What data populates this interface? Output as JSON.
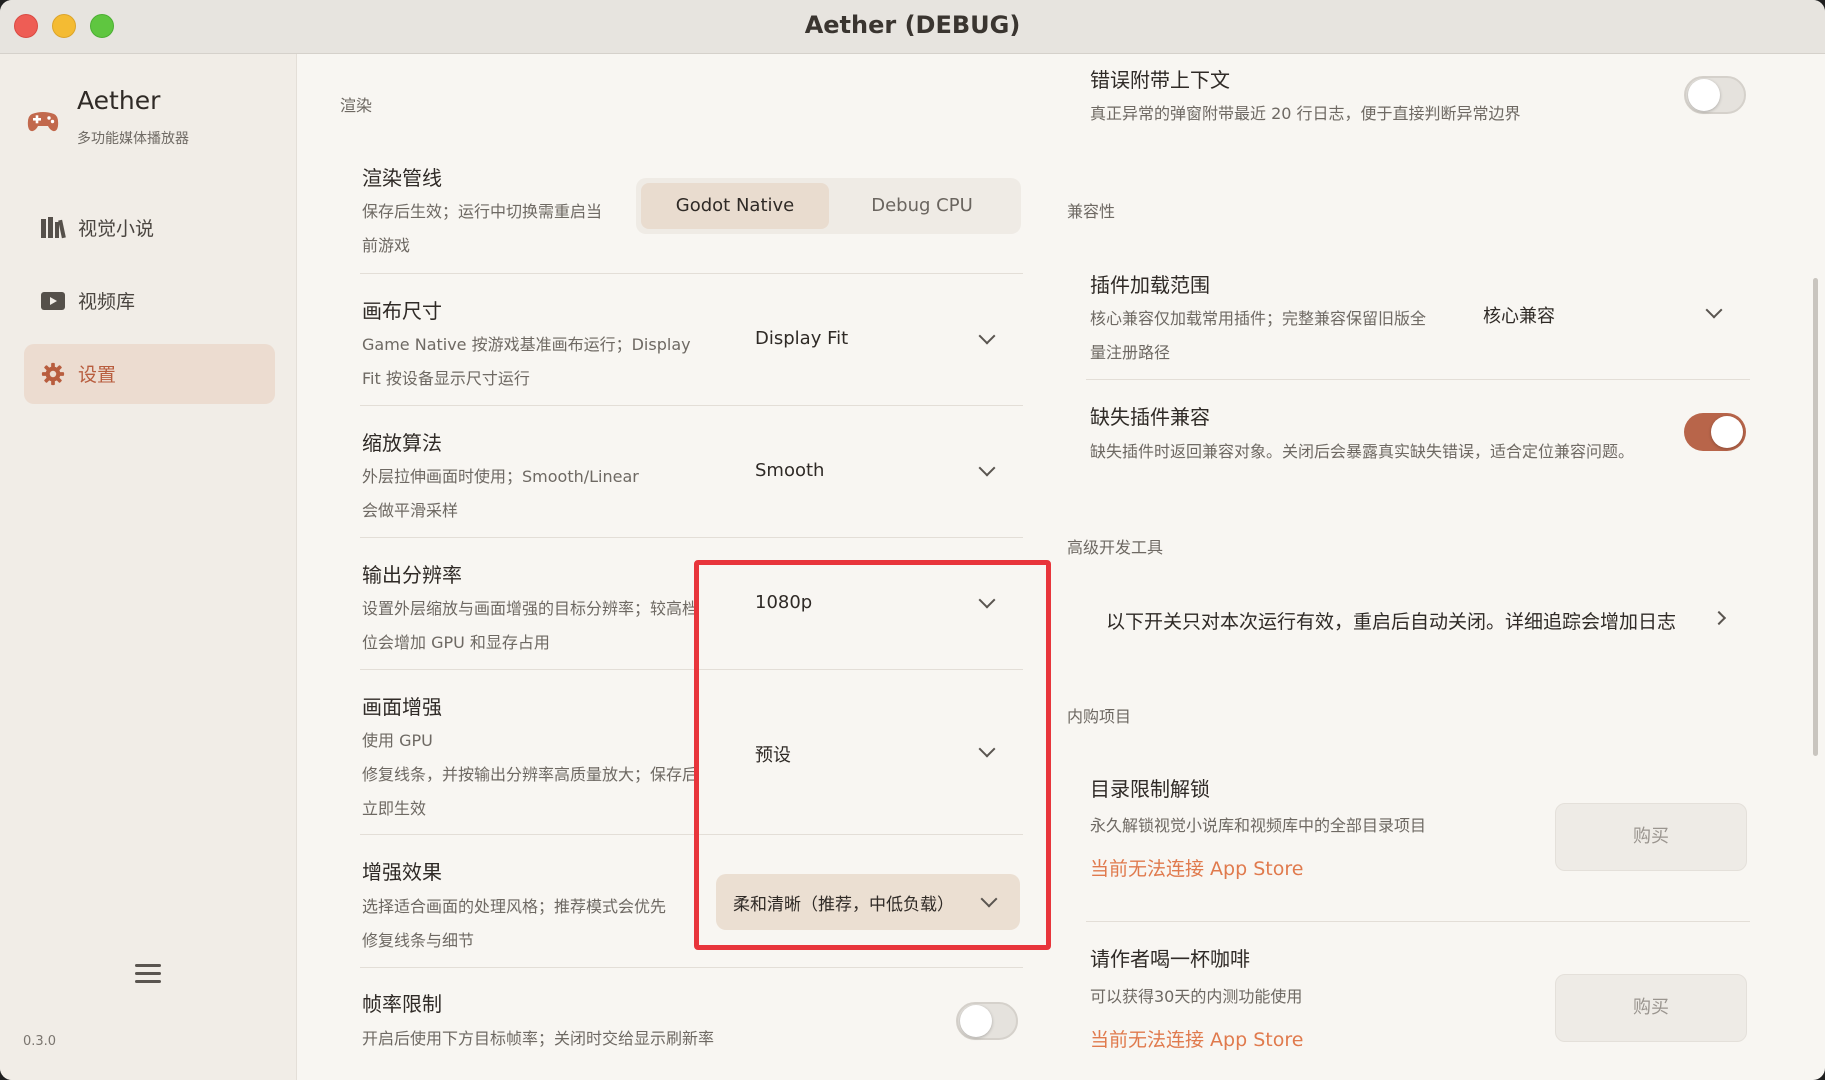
{
  "window": {
    "title": "Aether (DEBUG)"
  },
  "sidebar": {
    "app_name": "Aether",
    "app_subtitle": "多功能媒体播放器",
    "items": [
      {
        "label": "视觉小说",
        "icon": "books-icon"
      },
      {
        "label": "视频库",
        "icon": "video-icon"
      },
      {
        "label": "设置",
        "icon": "gear-icon",
        "active": true
      }
    ],
    "version": "0.3.0"
  },
  "render": {
    "section": "渲染",
    "pipeline": {
      "title": "渲染管线",
      "desc_line1": "保存后生效；运行中切换需重启当",
      "desc_line2": "前游戏",
      "options": [
        "Godot Native",
        "Debug CPU"
      ],
      "selected": "Godot Native"
    },
    "canvas": {
      "title": "画布尺寸",
      "desc_line1": "Game Native 按游戏基准画布运行；Display",
      "desc_line2": "Fit 按设备显示尺寸运行",
      "value": "Display Fit"
    },
    "scaling": {
      "title": "缩放算法",
      "desc_line1": "外层拉伸画面时使用；Smooth/Linear",
      "desc_line2": "会做平滑采样",
      "value": "Smooth"
    },
    "resolution": {
      "title": "输出分辨率",
      "desc_line1": "设置外层缩放与画面增强的目标分辨率；较高档",
      "desc_line2": "位会增加 GPU 和显存占用",
      "value": "1080p"
    },
    "enhance": {
      "title": "画面增强",
      "desc_line1": "使用 GPU",
      "desc_line2": "修复线条，并按输出分辨率高质量放大；保存后",
      "desc_line3": "立即生效",
      "value": "预设"
    },
    "effect": {
      "title": "增强效果",
      "desc_line1": "选择适合画面的处理风格；推荐模式会优先",
      "desc_line2": "修复线条与细节",
      "value": "柔和清晰（推荐，中低负载）"
    },
    "framerate": {
      "title": "帧率限制",
      "desc": "开启后使用下方目标帧率；关闭时交给显示刷新率",
      "enabled": false
    }
  },
  "right": {
    "error_context": {
      "title": "错误附带上下文",
      "desc": "真正异常的弹窗附带最近 20 行日志，便于直接判断异常边界",
      "enabled": false
    },
    "compat": {
      "section": "兼容性",
      "plugin_scope": {
        "title": "插件加载范围",
        "desc_line1": "核心兼容仅加载常用插件；完整兼容保留旧版全",
        "desc_line2": "量注册路径",
        "value": "核心兼容"
      },
      "missing_plugin": {
        "title": "缺失插件兼容",
        "desc": "缺失插件时返回兼容对象。关闭后会暴露真实缺失错误，适合定位兼容问题。",
        "enabled": true
      }
    },
    "devtools": {
      "section": "高级开发工具",
      "text": "以下开关只对本次运行有效，重启后自动关闭。详细追踪会增加日志"
    },
    "iap": {
      "section": "内购项目",
      "unlock": {
        "title": "目录限制解锁",
        "desc": "永久解锁视觉小说库和视频库中的全部目录项目",
        "warn": "当前无法连接 App Store",
        "button": "购买"
      },
      "coffee": {
        "title": "请作者喝一杯咖啡",
        "desc": "可以获得30天的内测功能使用",
        "warn": "当前无法连接 App Store",
        "button": "购买"
      }
    }
  },
  "colors": {
    "accent": "#b8654a",
    "warning_link": "#e07a4d",
    "highlight_box": "#e8353b"
  }
}
